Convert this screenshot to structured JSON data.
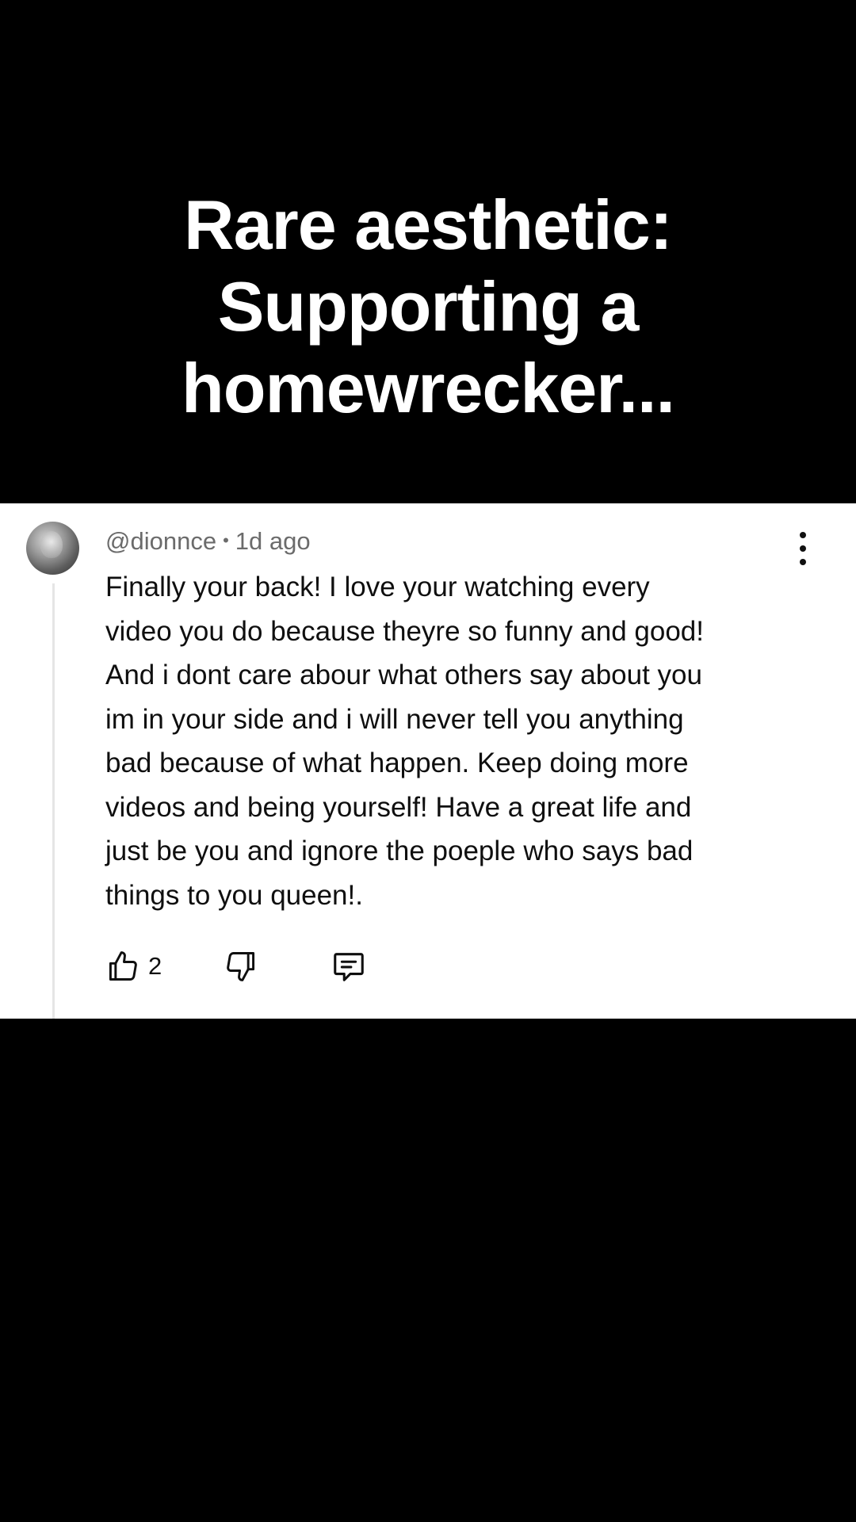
{
  "caption": {
    "lines": [
      "Rare aesthetic:",
      "Supporting a",
      "homewrecker..."
    ]
  },
  "comment": {
    "author": "@dionnce",
    "separator": "•",
    "time": "1d ago",
    "text": "Finally your back! I love your watching every\nvideo you do because theyre so funny and good!\nAnd i dont care abour what others say about you\nim in your side and i will never tell you anything\nbad because of what happen. Keep doing more\nvideos and being yourself! Have a great life and\njust be you and ignore the poeple who says bad\nthings to you queen!.",
    "like_count": "2",
    "icons": {
      "more": "more-vert-icon",
      "like": "thumbs-up-icon",
      "dislike": "thumbs-down-icon",
      "reply": "reply-comment-icon"
    }
  },
  "colors": {
    "background": "#000000",
    "card": "#ffffff",
    "meta_text": "#6b6b6b",
    "body_text": "#0f0f0f",
    "thread_line": "#e5e5e5"
  }
}
